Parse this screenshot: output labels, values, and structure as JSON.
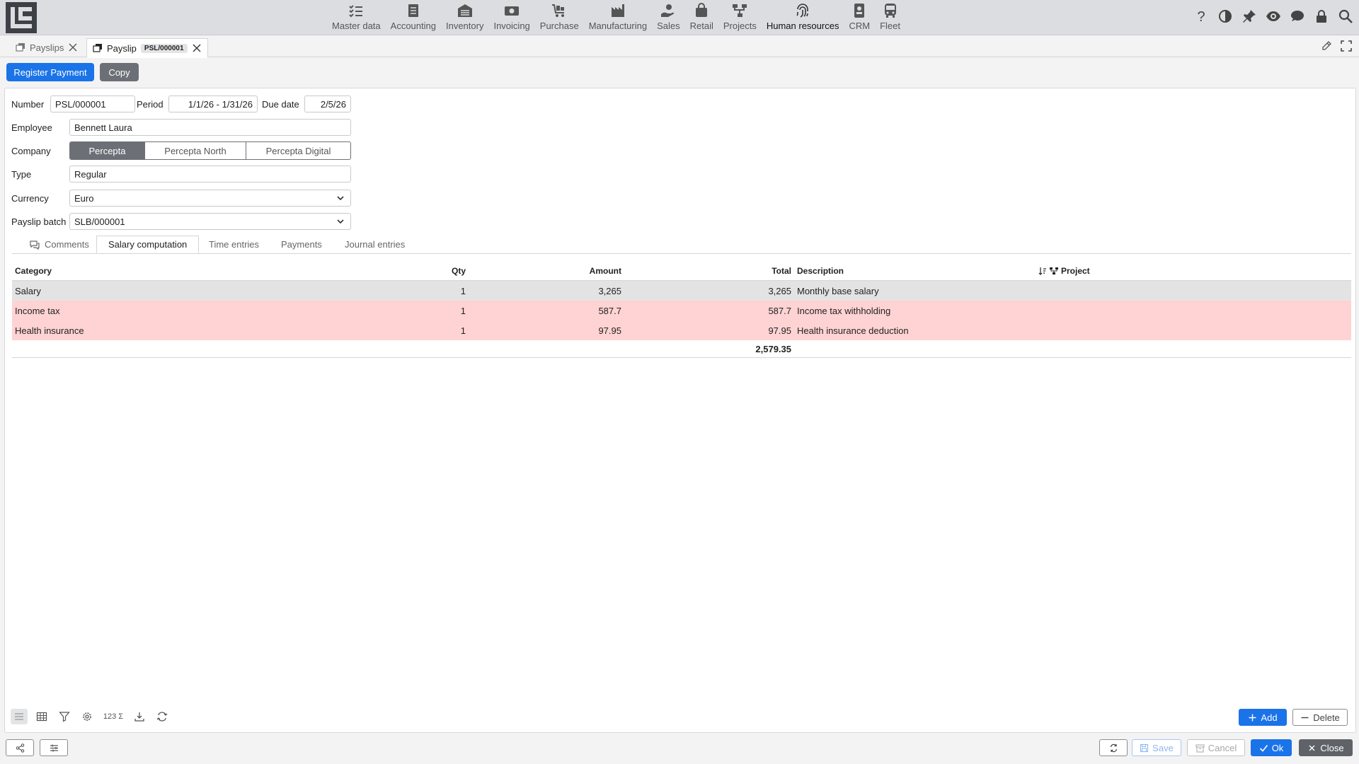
{
  "nav": {
    "modules": [
      {
        "label": "Master data",
        "icon": "checklist-icon"
      },
      {
        "label": "Accounting",
        "icon": "ledger-icon"
      },
      {
        "label": "Inventory",
        "icon": "warehouse-icon"
      },
      {
        "label": "Invoicing",
        "icon": "cash-icon"
      },
      {
        "label": "Purchase",
        "icon": "cart-icon"
      },
      {
        "label": "Manufacturing",
        "icon": "factory-icon"
      },
      {
        "label": "Sales",
        "icon": "hand-coin-icon"
      },
      {
        "label": "Retail",
        "icon": "shopping-bag-icon"
      },
      {
        "label": "Projects",
        "icon": "project-tree-icon"
      },
      {
        "label": "Human resources",
        "icon": "fingerprint-icon"
      },
      {
        "label": "CRM",
        "icon": "contact-card-icon"
      },
      {
        "label": "Fleet",
        "icon": "bus-icon"
      }
    ],
    "active_module": "Human resources",
    "right_icons": [
      "help-icon",
      "contrast-icon",
      "pin-icon",
      "eye-icon",
      "chat-icon",
      "lock-icon",
      "search-icon"
    ]
  },
  "tabs": [
    {
      "label": "Payslips"
    },
    {
      "label": "Payslip",
      "badge": "PSL/000001"
    }
  ],
  "actions": {
    "register_payment": "Register Payment",
    "copy": "Copy"
  },
  "form": {
    "number_label": "Number",
    "number_value": "PSL/000001",
    "period_label": "Period",
    "period_value": "1/1/26 - 1/31/26",
    "due_date_label": "Due date",
    "due_date_value": "2/5/26",
    "employee_label": "Employee",
    "employee_value": "Bennett Laura",
    "company_label": "Company",
    "company_options": [
      "Percepta",
      "Percepta North",
      "Percepta Digital"
    ],
    "company_selected": "Percepta",
    "type_label": "Type",
    "type_value": "Regular",
    "currency_label": "Currency",
    "currency_value": "Euro",
    "batch_label": "Payslip batch",
    "batch_value": "SLB/000001"
  },
  "inner_tabs": [
    "Comments",
    "Salary computation",
    "Time entries",
    "Payments",
    "Journal entries"
  ],
  "inner_tab_active": "Salary computation",
  "grid": {
    "headers": {
      "category": "Category",
      "qty": "Qty",
      "amount": "Amount",
      "total": "Total",
      "description": "Description",
      "project": "Project"
    },
    "rows": [
      {
        "category": "Salary",
        "qty": "1",
        "amount": "3,265",
        "total": "3,265",
        "description": "Monthly base salary",
        "style": "gray"
      },
      {
        "category": "Income tax",
        "qty": "1",
        "amount": "587.7",
        "total": "587.7",
        "description": "Income tax withholding",
        "style": "red"
      },
      {
        "category": "Health insurance",
        "qty": "1",
        "amount": "97.95",
        "total": "97.95",
        "description": "Health insurance deduction",
        "style": "red"
      }
    ],
    "sum_total": "2,579.35"
  },
  "grid_toolbar": {
    "sum_label": "123",
    "add": "Add",
    "delete": "Delete"
  },
  "footer": {
    "save": "Save",
    "cancel": "Cancel",
    "ok": "Ok",
    "close": "Close"
  },
  "colors": {
    "primary": "#1a73e8",
    "row_gray": "#e3e3e4",
    "row_red": "#ffd3d3",
    "segment_selected": "#6c7076"
  }
}
